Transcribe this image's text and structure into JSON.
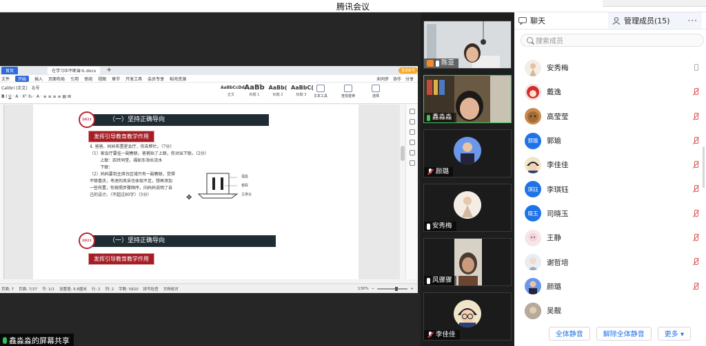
{
  "app": {
    "title": "腾讯会议"
  },
  "share": {
    "label": "鑫淼淼的屏幕共享"
  },
  "wps": {
    "tabs": [
      "首页",
      "在学习中不断奋斗.docx"
    ],
    "user": "登录账号",
    "menus": [
      "文件",
      "开始",
      "插入",
      "页面布局",
      "引用",
      "审阅",
      "视图",
      "章节",
      "开发工具",
      "会员专享",
      "稻壳资源"
    ],
    "menu_right": [
      "未同步",
      "协作",
      "分享"
    ],
    "font_name": "Calibri (正文)",
    "font_size": "五号",
    "styles": [
      {
        "sample": "AaBbCcDd",
        "caption": "正文"
      },
      {
        "sample": "AaBb",
        "caption": "标题 1"
      },
      {
        "sample": "AaBb(",
        "caption": "标题 2"
      },
      {
        "sample": "AaBbC(",
        "caption": "标题 3"
      }
    ],
    "ribbon_right": [
      "文本工具",
      "查找替换",
      "选择"
    ],
    "status": [
      "页面: 7",
      "页面: 7/27",
      "节: 1/1",
      "设置值: 9.8厘米",
      "行: 2",
      "列: 2",
      "字数: 5820",
      "拼写检查",
      "文档校对"
    ],
    "zoom": "130%"
  },
  "doc": {
    "section_title": "（一）坚持正确导向",
    "badge": "2021",
    "red_label": "发挥引导教育教学作用",
    "question": "4. 爸爸、妈妈布置星会厅，你去帮忙。（7分）\n（1）家会厅要挂一副春联，爸爸贴了上联，你对出下联。（2分）\n        上联：四世同堂，福如东海长流水\n        下联：\n（2）妈妈要到主席台区域只有一副春联，觉得\n不够喜庆，考虑的风采也体现不足，想再添加\n一些布置，你按照步骤顺序，向妈妈说明了自\n己的设计。（不超过80字）（5分）",
    "figure_labels": [
      "福座",
      "春联",
      "主席台"
    ]
  },
  "videos": [
    {
      "name": "陈亚",
      "mic": "host"
    },
    {
      "name": "鑫淼淼",
      "mic": "speaking"
    },
    {
      "name": "颜璐",
      "mic": "muted"
    },
    {
      "name": "安秀梅",
      "mic": "on"
    },
    {
      "name": "风骤骤",
      "mic": "on"
    },
    {
      "name": "李佳佳",
      "mic": "muted"
    }
  ],
  "panel": {
    "tab_chat": "聊天",
    "tab_members": "管理成员(15)",
    "more": "···",
    "search_placeholder": "搜索成员",
    "members": [
      {
        "name": "安秀梅",
        "avatar": "",
        "muted": false
      },
      {
        "name": "戴逸",
        "avatar": "",
        "muted": true
      },
      {
        "name": "高莹莹",
        "avatar": "",
        "muted": true
      },
      {
        "name": "郭瑜",
        "avatar": "郭瑜",
        "muted": true
      },
      {
        "name": "李佳佳",
        "avatar": "",
        "muted": true
      },
      {
        "name": "李琪钰",
        "avatar": "琪钰",
        "muted": true
      },
      {
        "name": "司晓玉",
        "avatar": "晓玉",
        "muted": true
      },
      {
        "name": "王静",
        "avatar": "",
        "muted": true
      },
      {
        "name": "谢哲培",
        "avatar": "",
        "muted": true
      },
      {
        "name": "颜璐",
        "avatar": "",
        "muted": true
      },
      {
        "name": "吴靓",
        "avatar": "",
        "muted": true
      }
    ],
    "btn_mute_all": "全体静音",
    "btn_unmute_all": "解除全体静音",
    "btn_more": "更多 ▾"
  },
  "colors": {
    "accent": "#1f73e8",
    "speaking": "#3ec35f",
    "muted": "#d9534f"
  }
}
